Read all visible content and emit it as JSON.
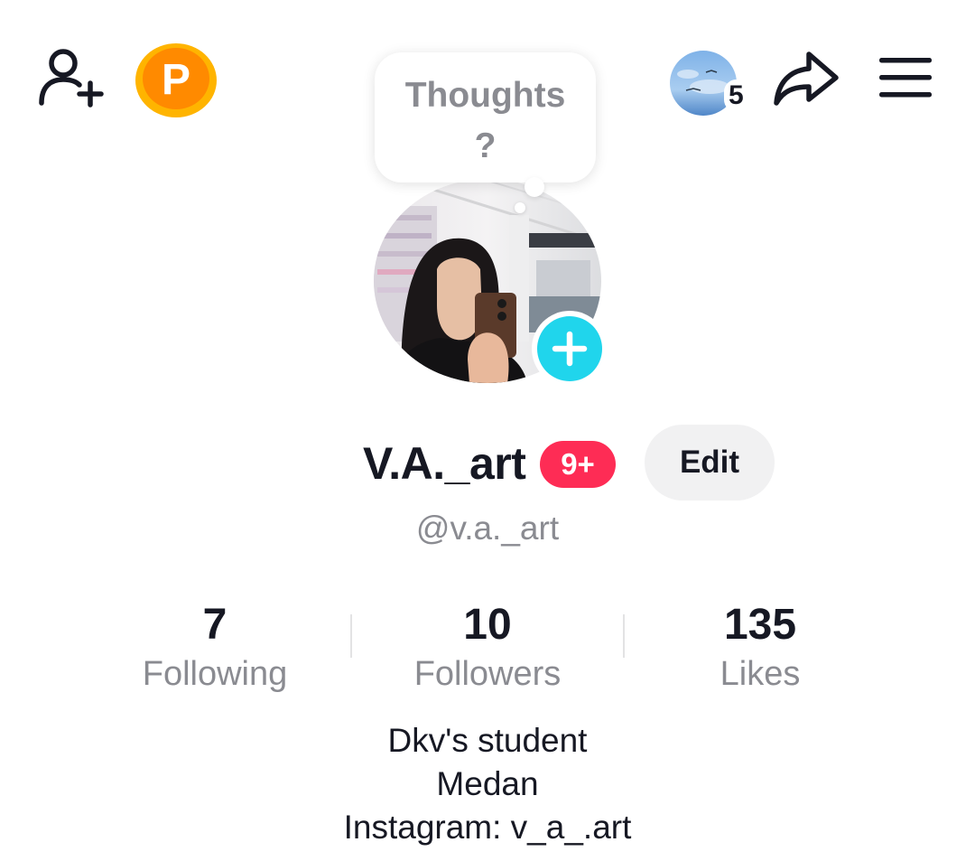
{
  "header": {
    "add_friend_icon": "person-add-icon",
    "points_icon": "points-coin-icon",
    "points_letter": "P",
    "story_count": "5",
    "share_icon": "share-arrow-icon",
    "menu_icon": "hamburger-menu-icon"
  },
  "thought_bubble": {
    "line1": "Thoughts",
    "line2": "?"
  },
  "profile": {
    "display_name": "V.A._art",
    "notification_badge": "9+",
    "edit_label": "Edit",
    "username": "@v.a._art"
  },
  "stats": [
    {
      "value": "7",
      "label": "Following"
    },
    {
      "value": "10",
      "label": "Followers"
    },
    {
      "value": "135",
      "label": "Likes"
    }
  ],
  "bio": {
    "line1": "Dkv's student",
    "line2": "Medan",
    "line3": "Instagram: v_a_.art"
  },
  "colors": {
    "accent_cyan": "#20d5ec",
    "badge_red": "#fe2c55",
    "coin_orange": "#ffb400",
    "text_primary": "#161823",
    "text_secondary": "#8a8b91"
  }
}
